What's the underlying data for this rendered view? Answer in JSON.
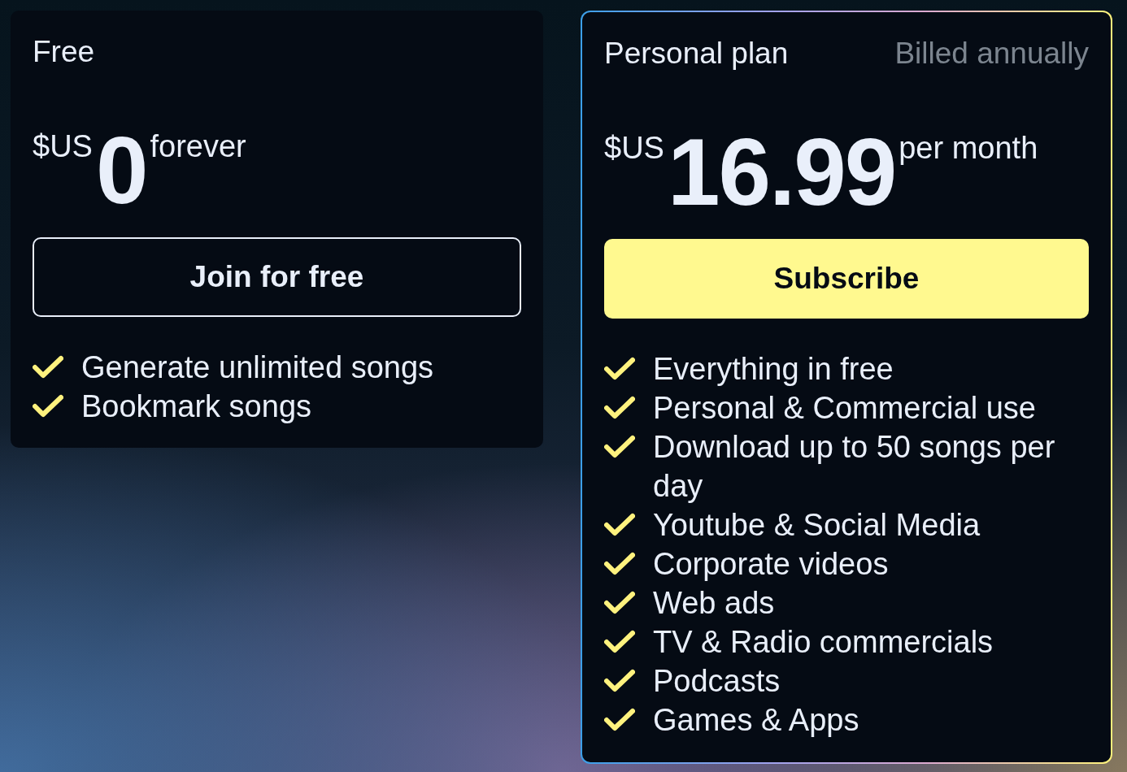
{
  "plans": [
    {
      "kind": "basic",
      "name": "Free",
      "currency": "$US",
      "amount": "0",
      "period": "forever",
      "button": {
        "label": "Join for free",
        "kind": "outline"
      },
      "features": [
        "Generate unlimited songs",
        "Bookmark songs"
      ]
    },
    {
      "kind": "featured",
      "name": "Personal plan",
      "billing": "Billed annually",
      "currency": "$US",
      "amount": "16.99",
      "period": "per month",
      "button": {
        "label": "Subscribe",
        "kind": "filled"
      },
      "features": [
        "Everything in free",
        "Personal & Commercial use",
        "Download up to 50 songs per day",
        "Youtube & Social Media",
        "Corporate videos",
        "Web ads",
        "TV & Radio commercials",
        "Podcasts",
        "Games & Apps"
      ]
    }
  ]
}
